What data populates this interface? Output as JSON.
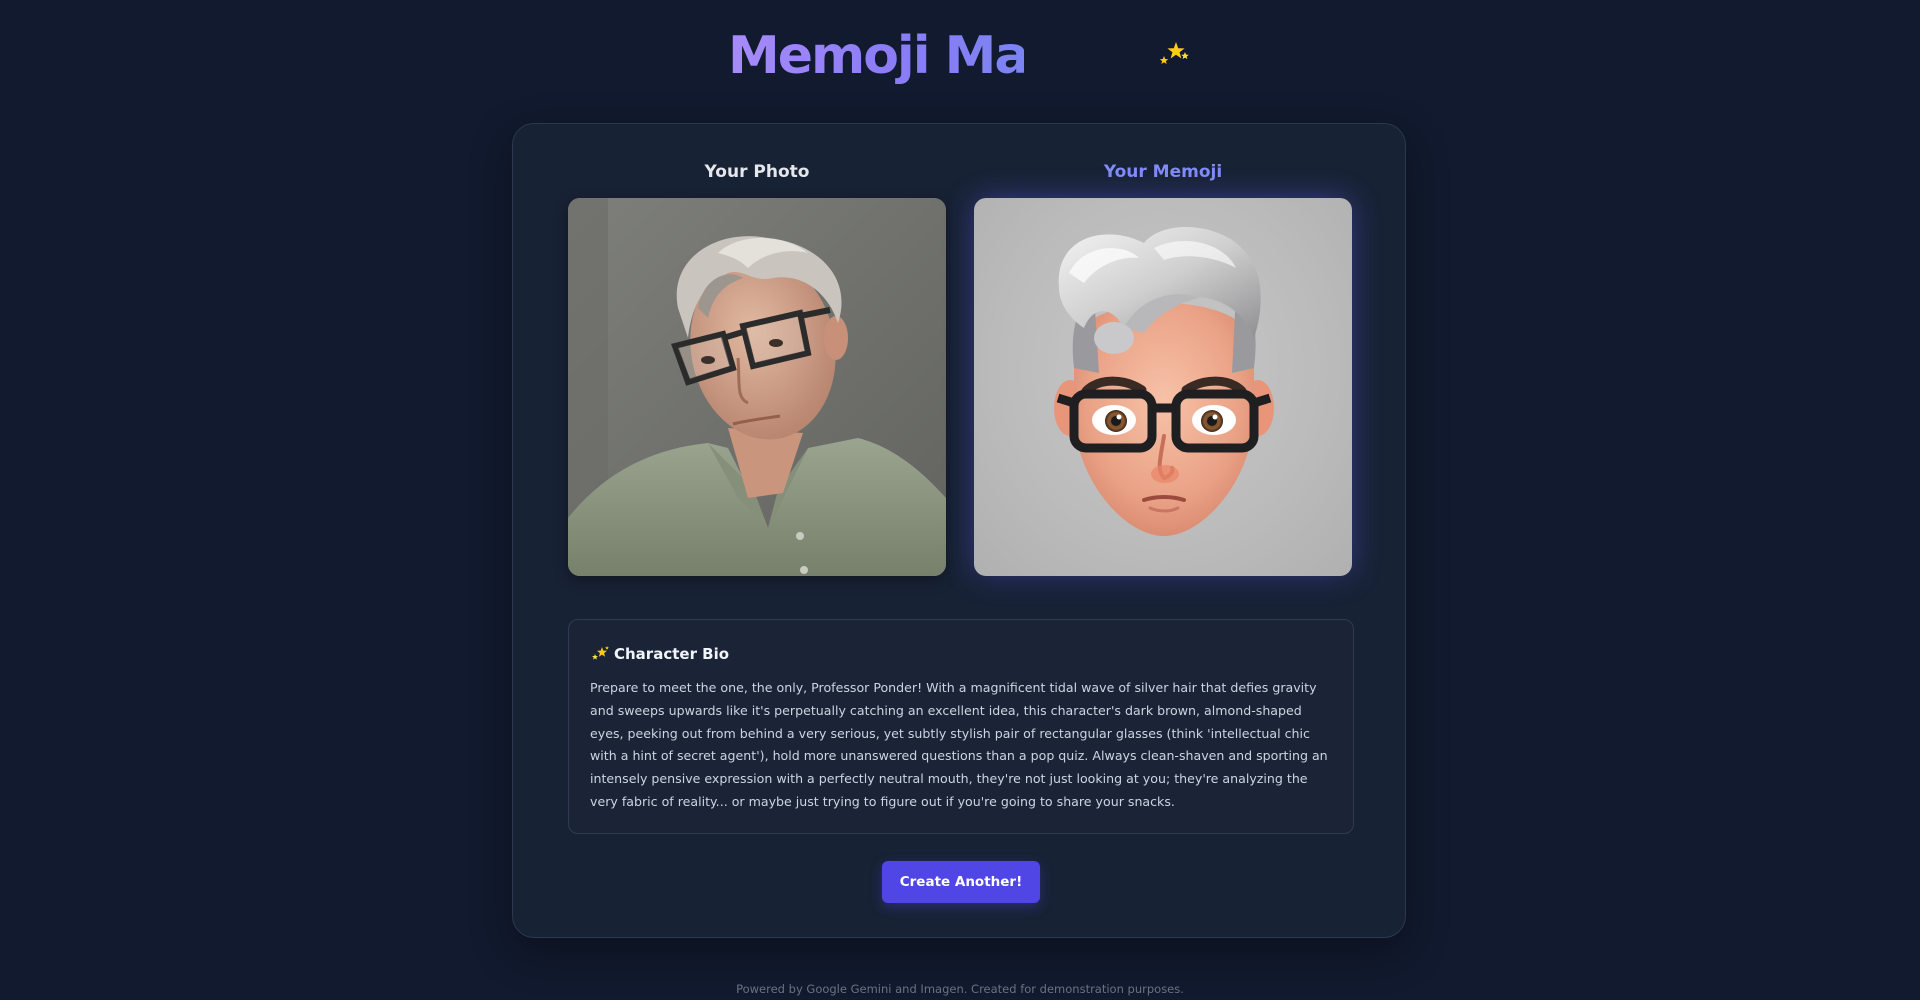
{
  "header": {
    "title": "Memoji Magic",
    "sparkle_icon": "sparkles-icon"
  },
  "columns": {
    "original": {
      "label": "Your Photo",
      "image_alt": "Uploaded photo of a man with gray hair and dark-rimmed glasses"
    },
    "generated": {
      "label": "Your Memoji",
      "image_alt": "Generated 3D memoji character with silver swept hair and rectangular glasses"
    }
  },
  "bio": {
    "icon": "sparkles-icon",
    "title": "Character Bio",
    "text": "Prepare to meet the one, the only, Professor Ponder! With a magnificent tidal wave of silver hair that defies gravity and sweeps upwards like it's perpetually catching an excellent idea, this character's dark brown, almond-shaped eyes, peeking out from behind a very serious, yet subtly stylish pair of rectangular glasses (think 'intellectual chic with a hint of secret agent'), hold more unanswered questions than a pop quiz. Always clean-shaven and sporting an intensely pensive expression with a perfectly neutral mouth, they're not just looking at you; they're analyzing the very fabric of reality... or maybe just trying to figure out if you're going to share your snacks."
  },
  "actions": {
    "create_label": "Create Another!"
  },
  "footer": {
    "text": "Powered by Google Gemini and Imagen. Created for demonstration purposes."
  },
  "colors": {
    "background": "#111a2e",
    "card": "#182235",
    "accent": "#4f46e5",
    "memoji_label": "#818cf8",
    "title_gradient_start": "#a78bfa",
    "title_gradient_end": "#7c83f2",
    "sparkle": "#facc15"
  }
}
